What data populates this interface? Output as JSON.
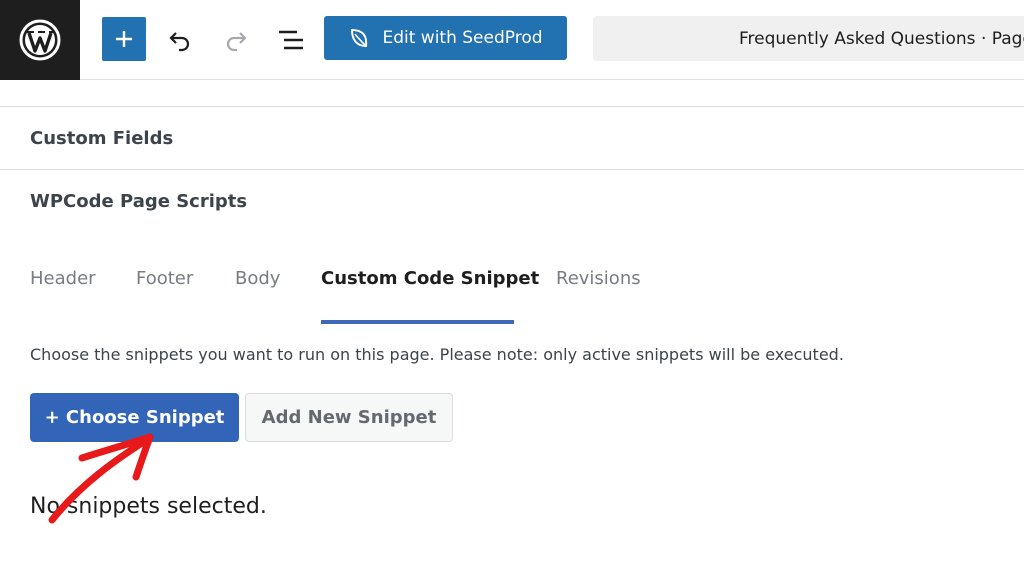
{
  "toolbar": {
    "logo_icon": "wordpress-logo-icon",
    "add_icon": "plus-icon",
    "undo_icon": "undo-icon",
    "redo_icon": "redo-icon",
    "outline_icon": "document-overview-icon",
    "seedprod_label": "Edit with SeedProd",
    "seedprod_icon": "seedprod-leaf-icon",
    "document_title": "Frequently Asked Questions · Page",
    "accent_color": "#2271b1"
  },
  "panels": {
    "custom_fields": "Custom Fields",
    "wpcode_scripts": "WPCode Page Scripts"
  },
  "tabs": [
    {
      "label": "Header",
      "active": false
    },
    {
      "label": "Footer",
      "active": false
    },
    {
      "label": "Body",
      "active": false
    },
    {
      "label": "Custom Code Snippet",
      "active": true
    },
    {
      "label": "Revisions",
      "active": false
    }
  ],
  "snippets": {
    "note": "Choose the snippets you want to run on this page. Please note: only active snippets will be executed.",
    "choose_label": "+ Choose Snippet",
    "add_new_label": "Add New Snippet",
    "empty_message": "No snippets selected."
  },
  "annotation": {
    "arrow_color": "#e8191a"
  }
}
